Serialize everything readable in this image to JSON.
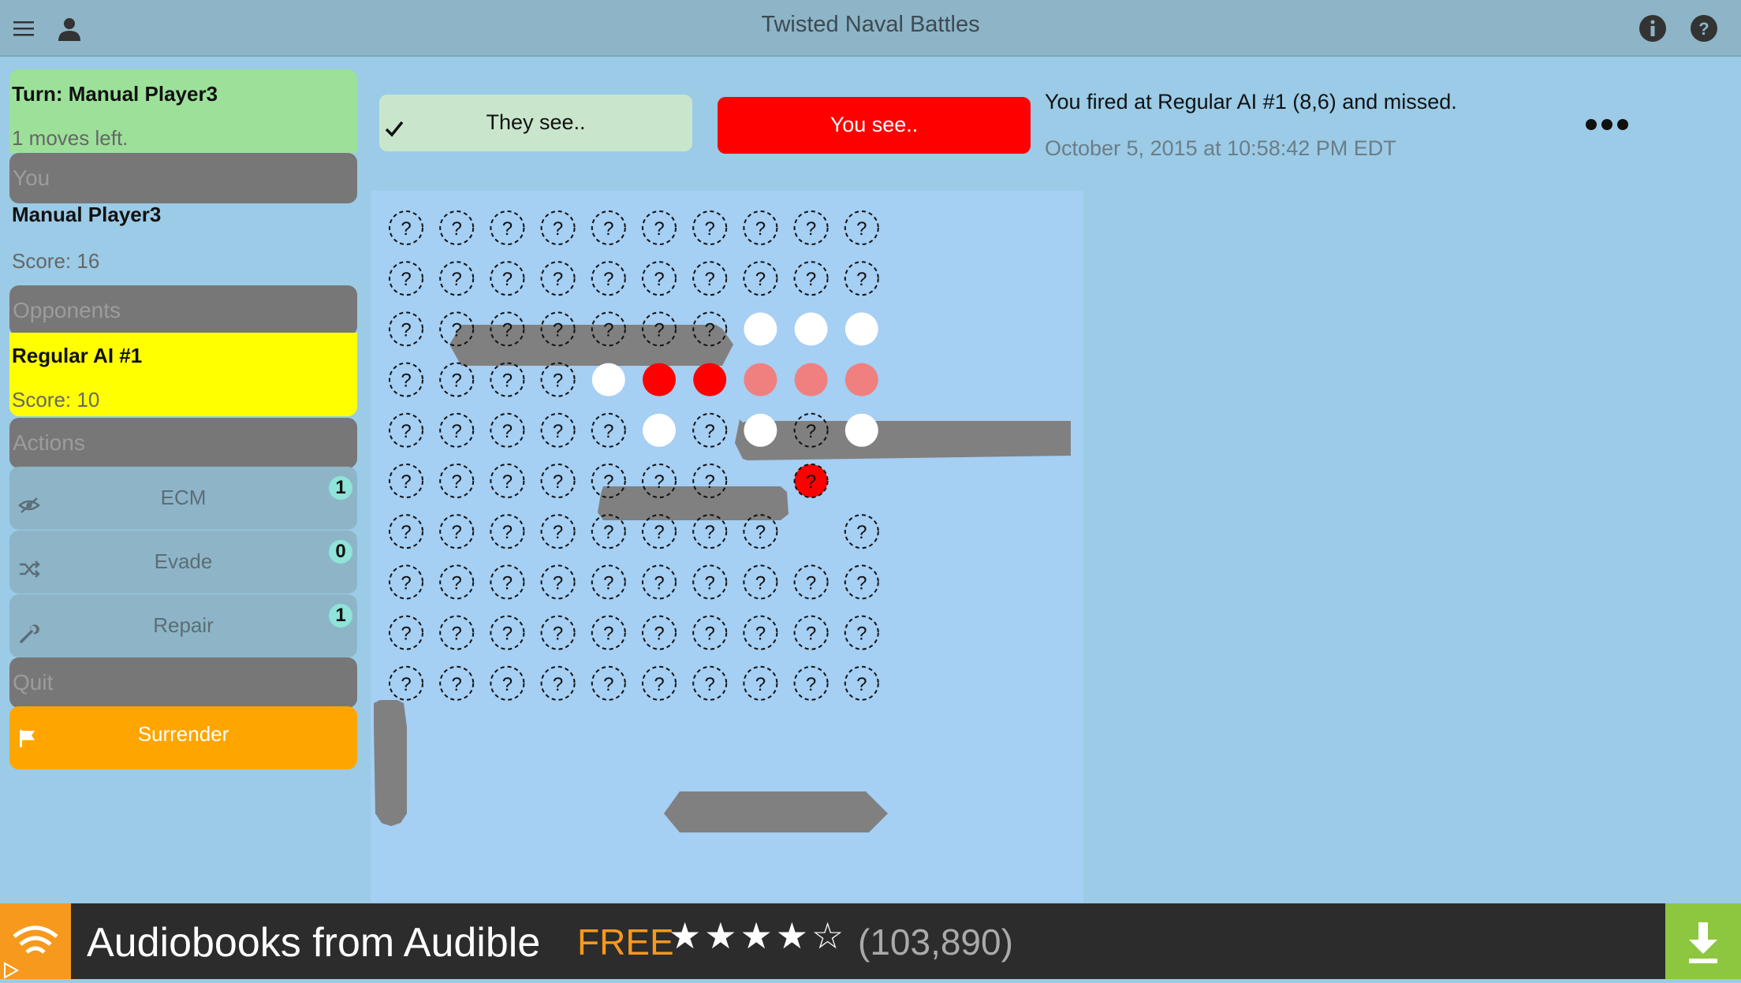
{
  "app": {
    "title": "Twisted Naval Battles"
  },
  "sidebar": {
    "turn_title": "Turn: Manual Player3",
    "moves_left": "1 moves left.",
    "you_header": "You",
    "player_name": "Manual Player3",
    "player_score": "Score: 16",
    "opponents_header": "Opponents",
    "opponent_name": "Regular AI #1",
    "opponent_score": "Score: 10",
    "actions_header": "Actions",
    "actions": [
      {
        "label": "ECM",
        "count": "1",
        "icon": "eye-slash-icon"
      },
      {
        "label": "Evade",
        "count": "0",
        "icon": "shuffle-icon"
      },
      {
        "label": "Repair",
        "count": "1",
        "icon": "wrench-icon"
      }
    ],
    "quit_header": "Quit",
    "surrender_label": "Surrender"
  },
  "controls": {
    "they_see": "They see..",
    "you_see": "You see.."
  },
  "message": {
    "text": "You fired at Regular AI #1 (8,6) and missed.",
    "time": "October 5, 2015 at 10:58:42 PM EDT"
  },
  "board": {
    "cols": 10,
    "rows": 10,
    "unknown_mark": "?",
    "legend": "u = unknown, m = miss (white), h = hit (red), d = damaged (light red), t = targeted unknown (red), e = empty",
    "grid": [
      "uuuuuuuuuu",
      "uuuuuuuuuu",
      "uuuuuuummm",
      "uuuumhhddd",
      "uuuuumumum",
      "uuuuuuuete",
      "uuuuuuuueu",
      "uuuuuuuuuu",
      "uuuuuuuuuu",
      "uuuuuuuuuu"
    ]
  },
  "colors": {
    "hit": "#ff0000",
    "damaged": "#f08080",
    "miss": "#ffffff",
    "ship": "#808080",
    "turn_bg": "#9de09a",
    "opponent_bg": "#ffff00",
    "surrender_bg": "#ffa500"
  },
  "ad": {
    "title": "Audiobooks from Audible",
    "free_label": "FREE",
    "stars": "★★★★☆",
    "count": "(103,890)"
  }
}
